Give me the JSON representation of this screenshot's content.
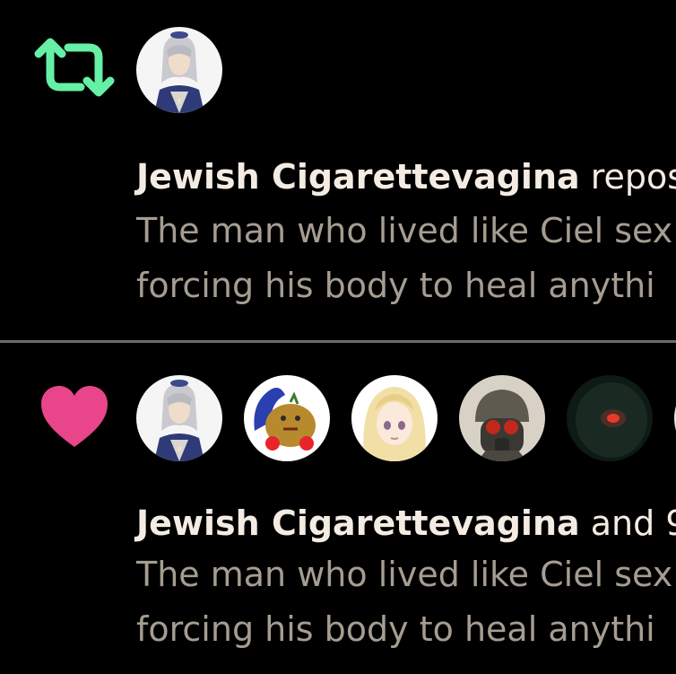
{
  "colors": {
    "background": "#000000",
    "repost_green": "#66f0a6",
    "like_pink": "#e8458b",
    "name_text": "#f4ece2",
    "preview_text": "#a59d91",
    "divider": "#6e6a66"
  },
  "notifications": [
    {
      "type": "repost",
      "icon": "repost-icon",
      "actor_name": "Jewish Cigarettevagina",
      "action_text": "repos",
      "preview_lines": [
        "The man who lived like Ciel sex",
        "forcing his body to heal anythi"
      ]
    },
    {
      "type": "like",
      "icon": "heart-icon",
      "actor_name": "Jewish Cigarettevagina",
      "action_text": "and 9",
      "preview_lines": [
        "The man who lived like Ciel sex",
        "forcing his body to heal anythi"
      ]
    }
  ]
}
